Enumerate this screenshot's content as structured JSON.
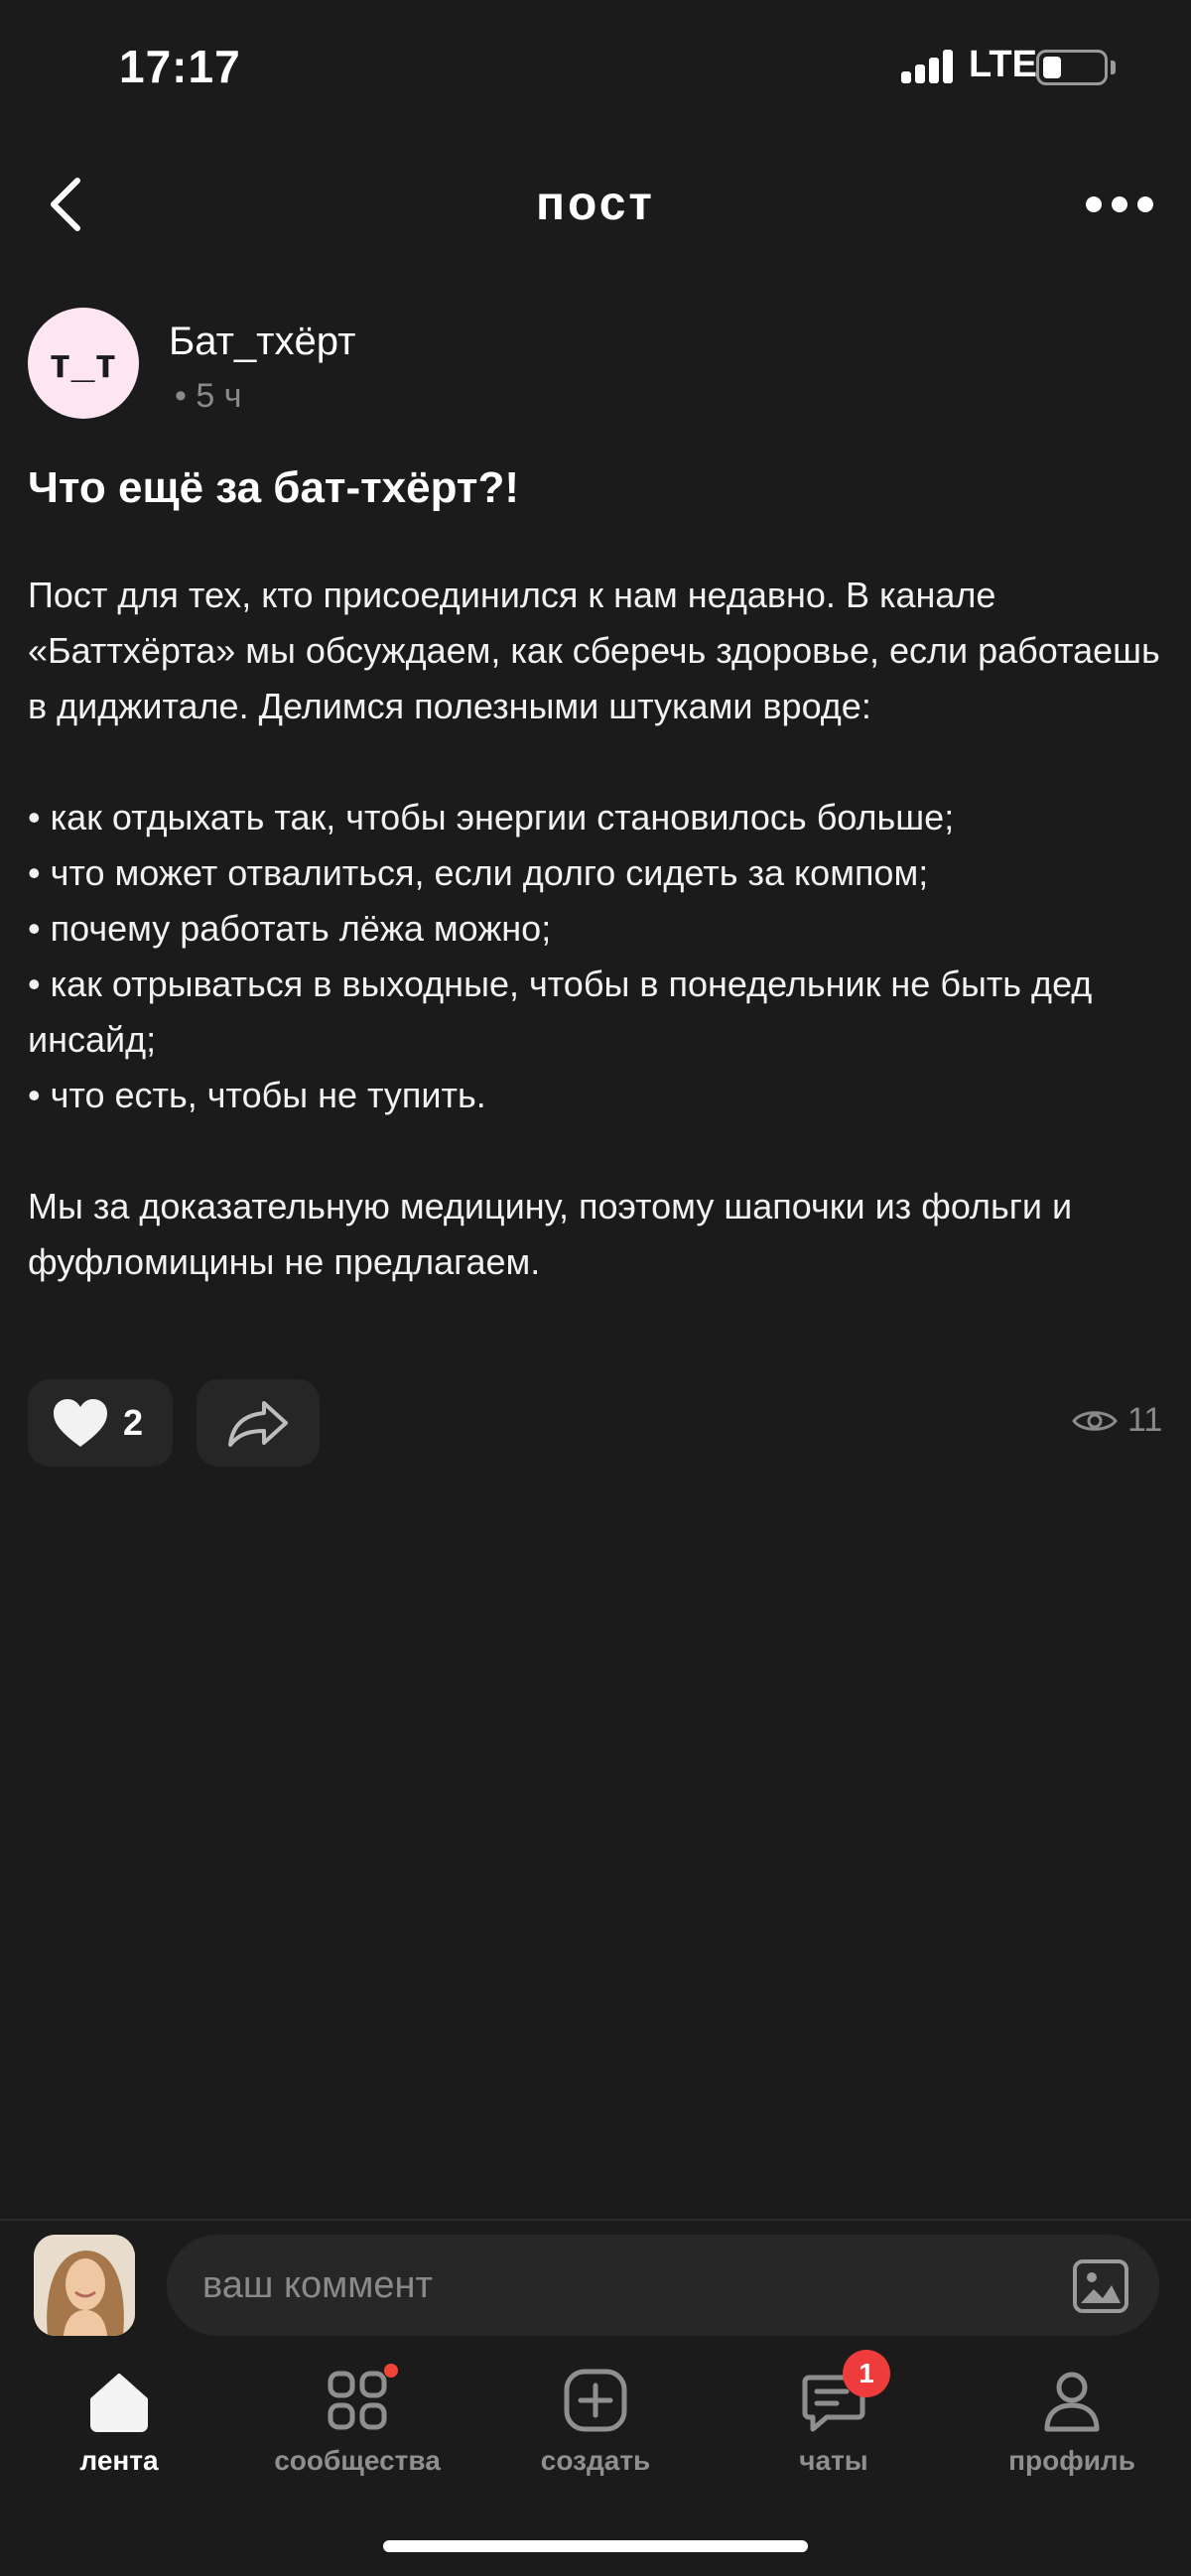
{
  "status_bar": {
    "time": "17:17",
    "network": "LTE"
  },
  "header": {
    "title": "пост"
  },
  "author": {
    "avatar_text": "т_т",
    "name": "Бат_тхёрт",
    "time": "• 5 ч"
  },
  "post": {
    "title": "Что ещё за бат-тхёрт?!",
    "intro": "Пост для тех, кто присоединился к нам недавно. В канале «Баттхёрта» мы обсуждаем, как сберечь здоровье, если работаешь в диджитале. Делимся полезными штуками вроде:",
    "bullets": [
      "• как отдыхать так, чтобы энергии становилось больше;",
      "• что может отвалиться, если долго сидеть за компом;",
      "• почему работать лёжа можно;",
      "• как отрываться в выходные, чтобы в понедельник не быть дед инсайд;",
      "• что есть, чтобы не тупить."
    ],
    "outro": "Мы за доказательную медицину, поэтому шапочки из фольги и фуфломицины не предлагаем."
  },
  "actions": {
    "likes": "2",
    "views": "11"
  },
  "comment": {
    "placeholder": "ваш коммент"
  },
  "tabs": [
    {
      "label": "лента",
      "active": true
    },
    {
      "label": "сообщества"
    },
    {
      "label": "создать"
    },
    {
      "label": "чаты",
      "badge": "1"
    },
    {
      "label": "профиль"
    }
  ],
  "colors": {
    "background": "#1b1b1b",
    "card": "#262626",
    "badge": "#ee3c3c",
    "author_avatar": "#fde6f1"
  },
  "icons": [
    "back-arrow-icon",
    "more-dots-icon",
    "heart-icon",
    "share-icon",
    "eye-icon",
    "image-icon",
    "home-icon",
    "grid-icon",
    "plus-square-icon",
    "chat-icon",
    "person-icon"
  ]
}
